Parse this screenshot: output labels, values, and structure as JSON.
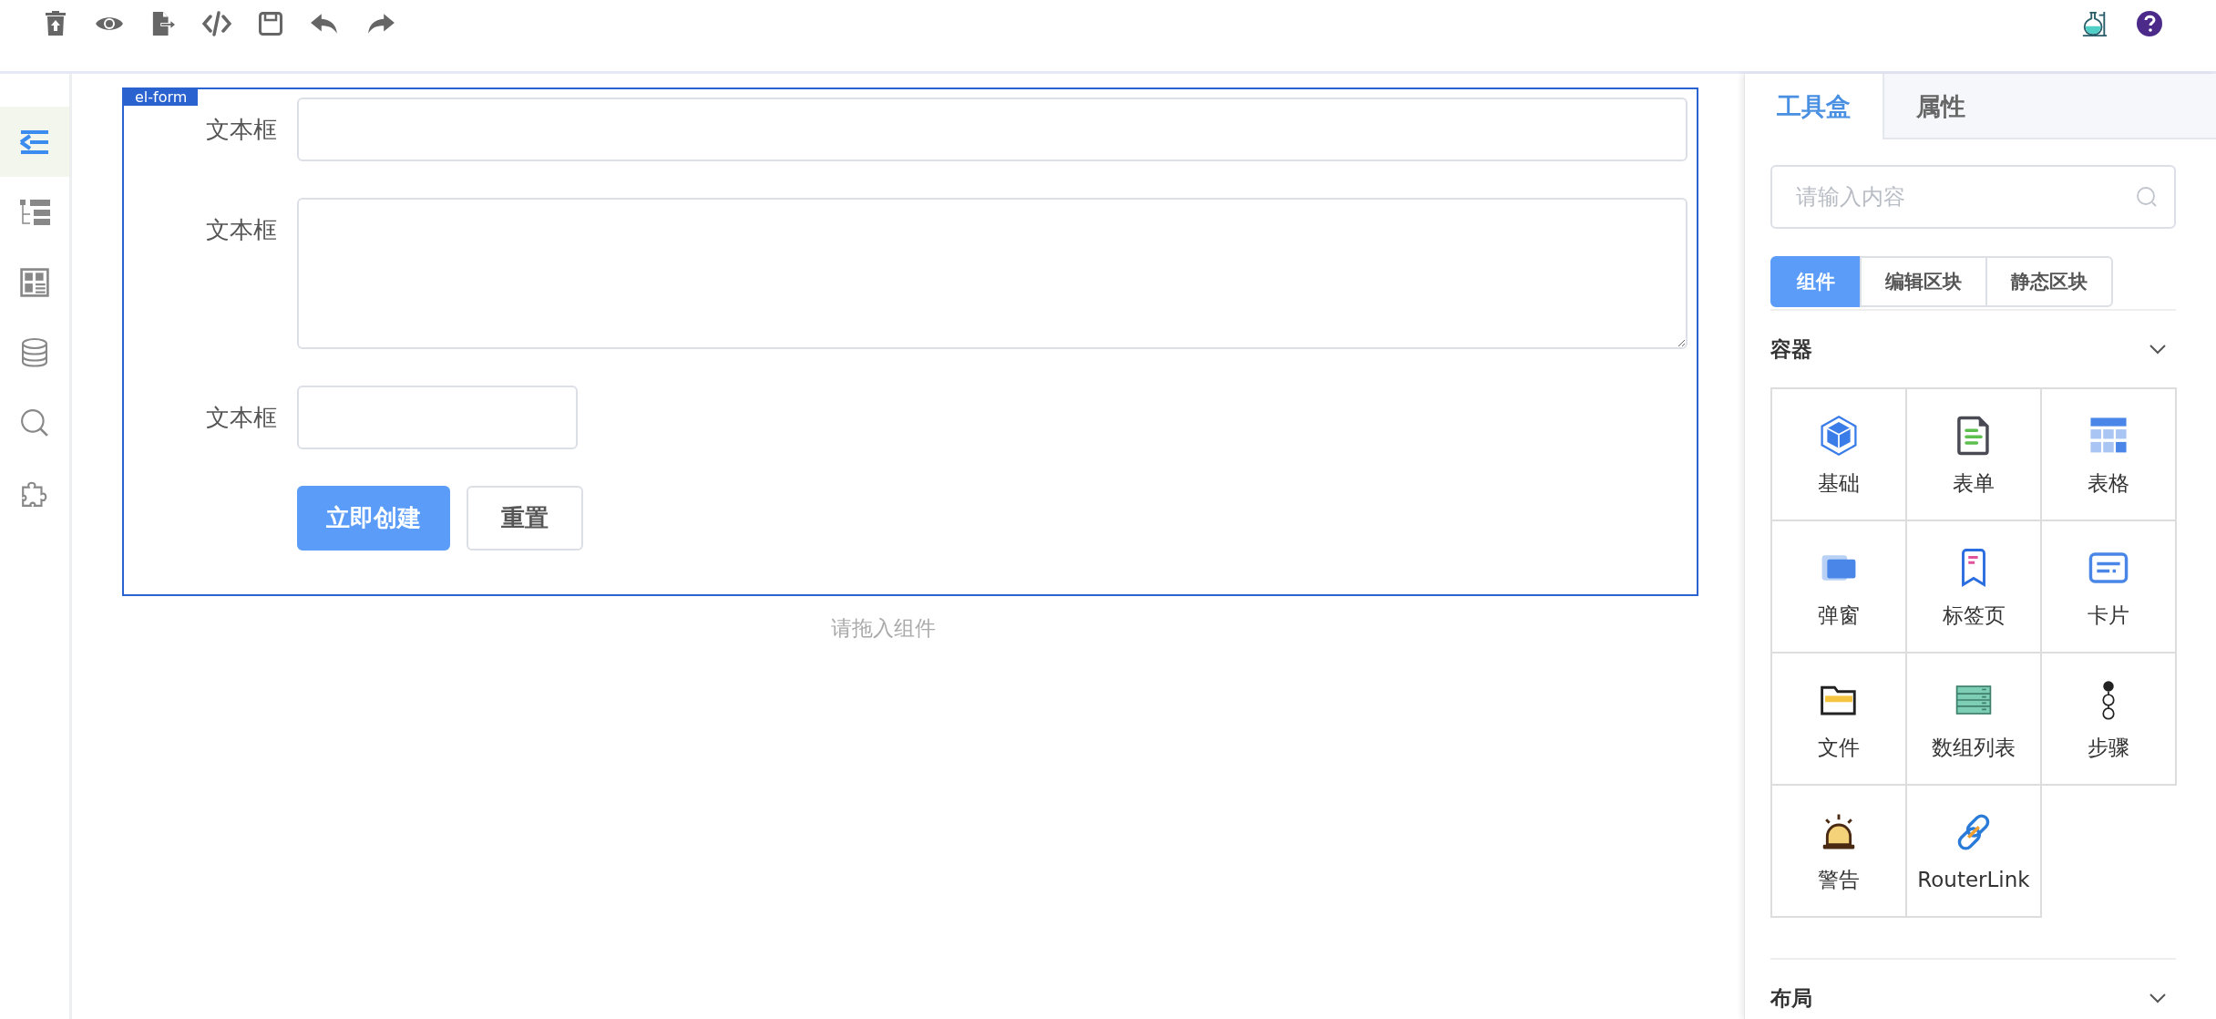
{
  "sidebar": {
    "items": [
      {
        "selected": true
      },
      {
        "selected": false
      },
      {
        "selected": false
      },
      {
        "selected": false
      },
      {
        "selected": false
      },
      {
        "selected": false
      }
    ]
  },
  "form": {
    "tag": "el-form",
    "fields": [
      {
        "label": "文本框",
        "kind": "input"
      },
      {
        "label": "文本框",
        "kind": "textarea"
      },
      {
        "label": "文本框",
        "kind": "short"
      }
    ],
    "buttons": [
      {
        "label": "立即创建",
        "kind": "primary"
      },
      {
        "label": "重置",
        "kind": "default"
      }
    ]
  },
  "drop_hint": "请拖入组件",
  "panel": {
    "tabs": [
      {
        "label": "工具盒",
        "selected": true
      },
      {
        "label": "属性",
        "selected": false
      }
    ],
    "search": {
      "placeholder": "请输入内容"
    },
    "segments": [
      {
        "label": "组件",
        "selected": true
      },
      {
        "label": "编辑区块",
        "selected": false
      },
      {
        "label": "静态区块",
        "selected": false
      }
    ],
    "sections": [
      {
        "title": "容器",
        "items": [
          {
            "label": "基础"
          },
          {
            "label": "表单"
          },
          {
            "label": "表格"
          },
          {
            "label": "弹窗"
          },
          {
            "label": "标签页"
          },
          {
            "label": "卡片"
          },
          {
            "label": "文件"
          },
          {
            "label": "数组列表"
          },
          {
            "label": "步骤"
          },
          {
            "label": "警告"
          },
          {
            "label": "RouterLink"
          }
        ]
      },
      {
        "title": "布局"
      }
    ]
  }
}
